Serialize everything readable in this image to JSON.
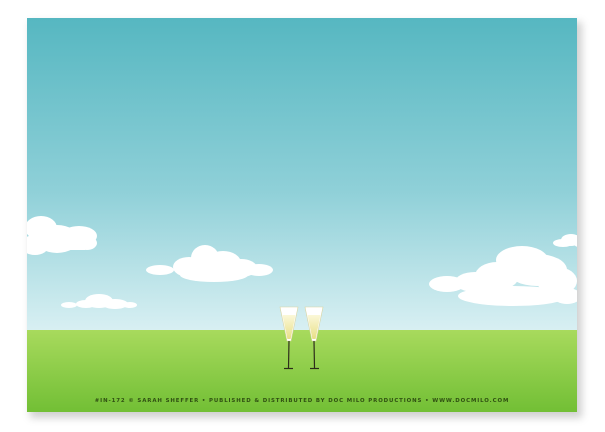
{
  "card": {
    "credit_line": "#IN-172 © SARAH SHEFFER • PUBLISHED & DISTRIBUTED BY DOC MILO PRODUCTIONS • WWW.DOCMILO.COM"
  },
  "scene": {
    "sky_colors": [
      "#58b8c2",
      "#d4eef2"
    ],
    "grass_colors": [
      "#a6d85a",
      "#6fbd32"
    ],
    "cloud_color": "#ffffff",
    "glass_color": "#f4f0b0",
    "glass_stem_color": "#2d2d1a",
    "objects": [
      "cloud",
      "cloud",
      "cloud",
      "cloud",
      "cloud",
      "champagne-glass",
      "champagne-glass"
    ]
  }
}
